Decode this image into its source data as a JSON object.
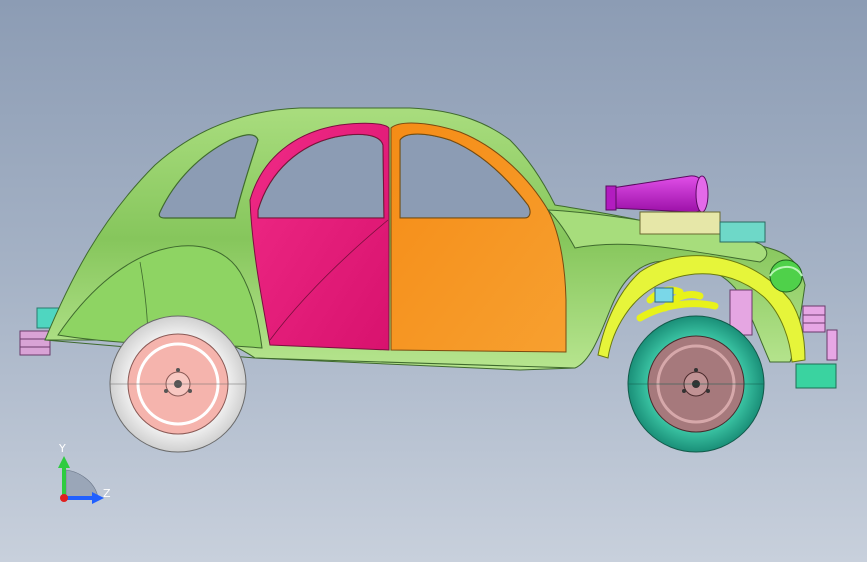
{
  "viewport": {
    "background_top": "#8c9cb4",
    "background_bottom": "#c8d0dc"
  },
  "model": {
    "body_color": "#8fcf66",
    "front_door_color": "#e8197a",
    "rear_door_color": "#f7921f",
    "rear_wheel_tire_color": "#f2f2f2",
    "rear_wheel_rim_color": "#f3a8a0",
    "front_wheel_tire_color": "#2bb89a",
    "front_wheel_rim_color": "#a8777a",
    "engine_intake_color": "#c51bd1",
    "exhaust_headers_color": "#e8f21a",
    "headlight_color": "#4fd14a"
  },
  "triad": {
    "y_label": "Y",
    "z_label": "Z",
    "y_color": "#2ecc40",
    "z_color": "#2060ff",
    "origin_color": "#e02020"
  }
}
